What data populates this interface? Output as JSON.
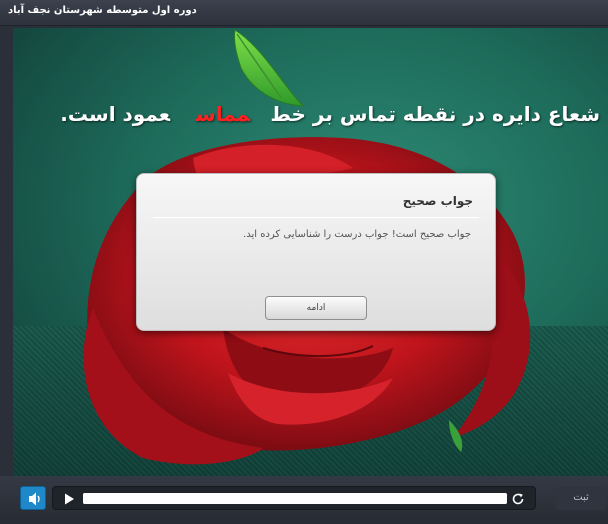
{
  "window": {
    "title": "دوره اول متوسطه شهرستان نجف آباد"
  },
  "slide": {
    "heading_part1": "شعاع دایره در نقطه تماس بر خط",
    "heading_keyword": "مماس",
    "heading_part2": "عمود است.",
    "keyword_color": "#ff2020",
    "background_color": "#1e6d5c"
  },
  "dialog": {
    "title": "جواب صحیح",
    "message": "جواب صحیح است! جواب درست را شناسایی کرده اید.",
    "continue_label": "ادامه"
  },
  "player": {
    "volume_icon": "speaker-icon",
    "play_icon": "play-icon",
    "replay_icon": "replay-icon",
    "progress": 1.0,
    "submit_label": "ثبت",
    "accent_color": "#1e88c8"
  }
}
